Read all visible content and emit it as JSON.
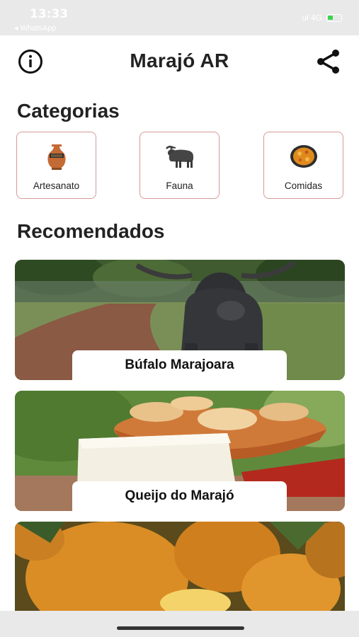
{
  "status": {
    "time": "13:33",
    "back_label": "◂ WhatsApp",
    "signal": "ul 4G"
  },
  "header": {
    "title": "Marajó AR",
    "info_icon": "info-icon",
    "share_icon": "share-icon"
  },
  "categories": {
    "title": "Categorias",
    "items": [
      {
        "label": "Artesanato",
        "icon": "vase-icon"
      },
      {
        "label": "Fauna",
        "icon": "buffalo-icon"
      },
      {
        "label": "Comidas",
        "icon": "dish-icon"
      }
    ]
  },
  "recommended": {
    "title": "Recomendados",
    "items": [
      {
        "label": "Búfalo Marajoara"
      },
      {
        "label": "Queijo do Marajó"
      },
      {
        "label": ""
      }
    ]
  },
  "colors": {
    "card_border": "#d79a97",
    "text": "#222222",
    "status_bg": "#e9e9ea"
  }
}
